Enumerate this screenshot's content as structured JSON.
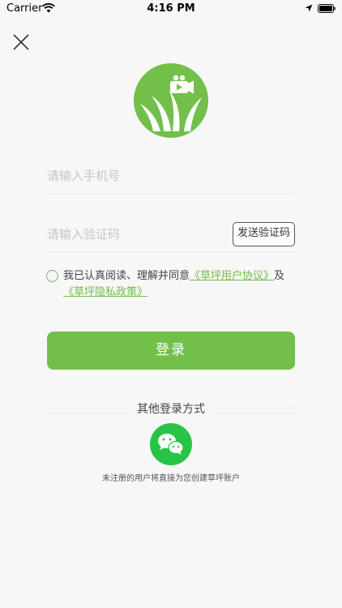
{
  "status_bar": {
    "carrier": "Carrier",
    "time": "4:16 PM"
  },
  "login": {
    "phone_placeholder": "请输入手机号",
    "code_placeholder": "请输入验证码",
    "send_code_label": "发送验证码",
    "agreement_prefix": "我已认真阅读、理解并同意",
    "user_agreement_link": "《草坪用户协议》",
    "agreement_joiner": "及",
    "privacy_policy_link": "《草坪隐私政策》",
    "login_button_label": "登录",
    "other_methods_title": "其他登录方式",
    "footer_note": "未注册的用户将直接为您创建草坪账户"
  },
  "icons": {
    "close": "close-icon",
    "logo": "lawn-logo",
    "wechat": "wechat-icon"
  },
  "colors": {
    "accent": "#72c04a",
    "link": "#6fbd48",
    "wechat": "#28c445",
    "background": "#f7f7f7"
  }
}
